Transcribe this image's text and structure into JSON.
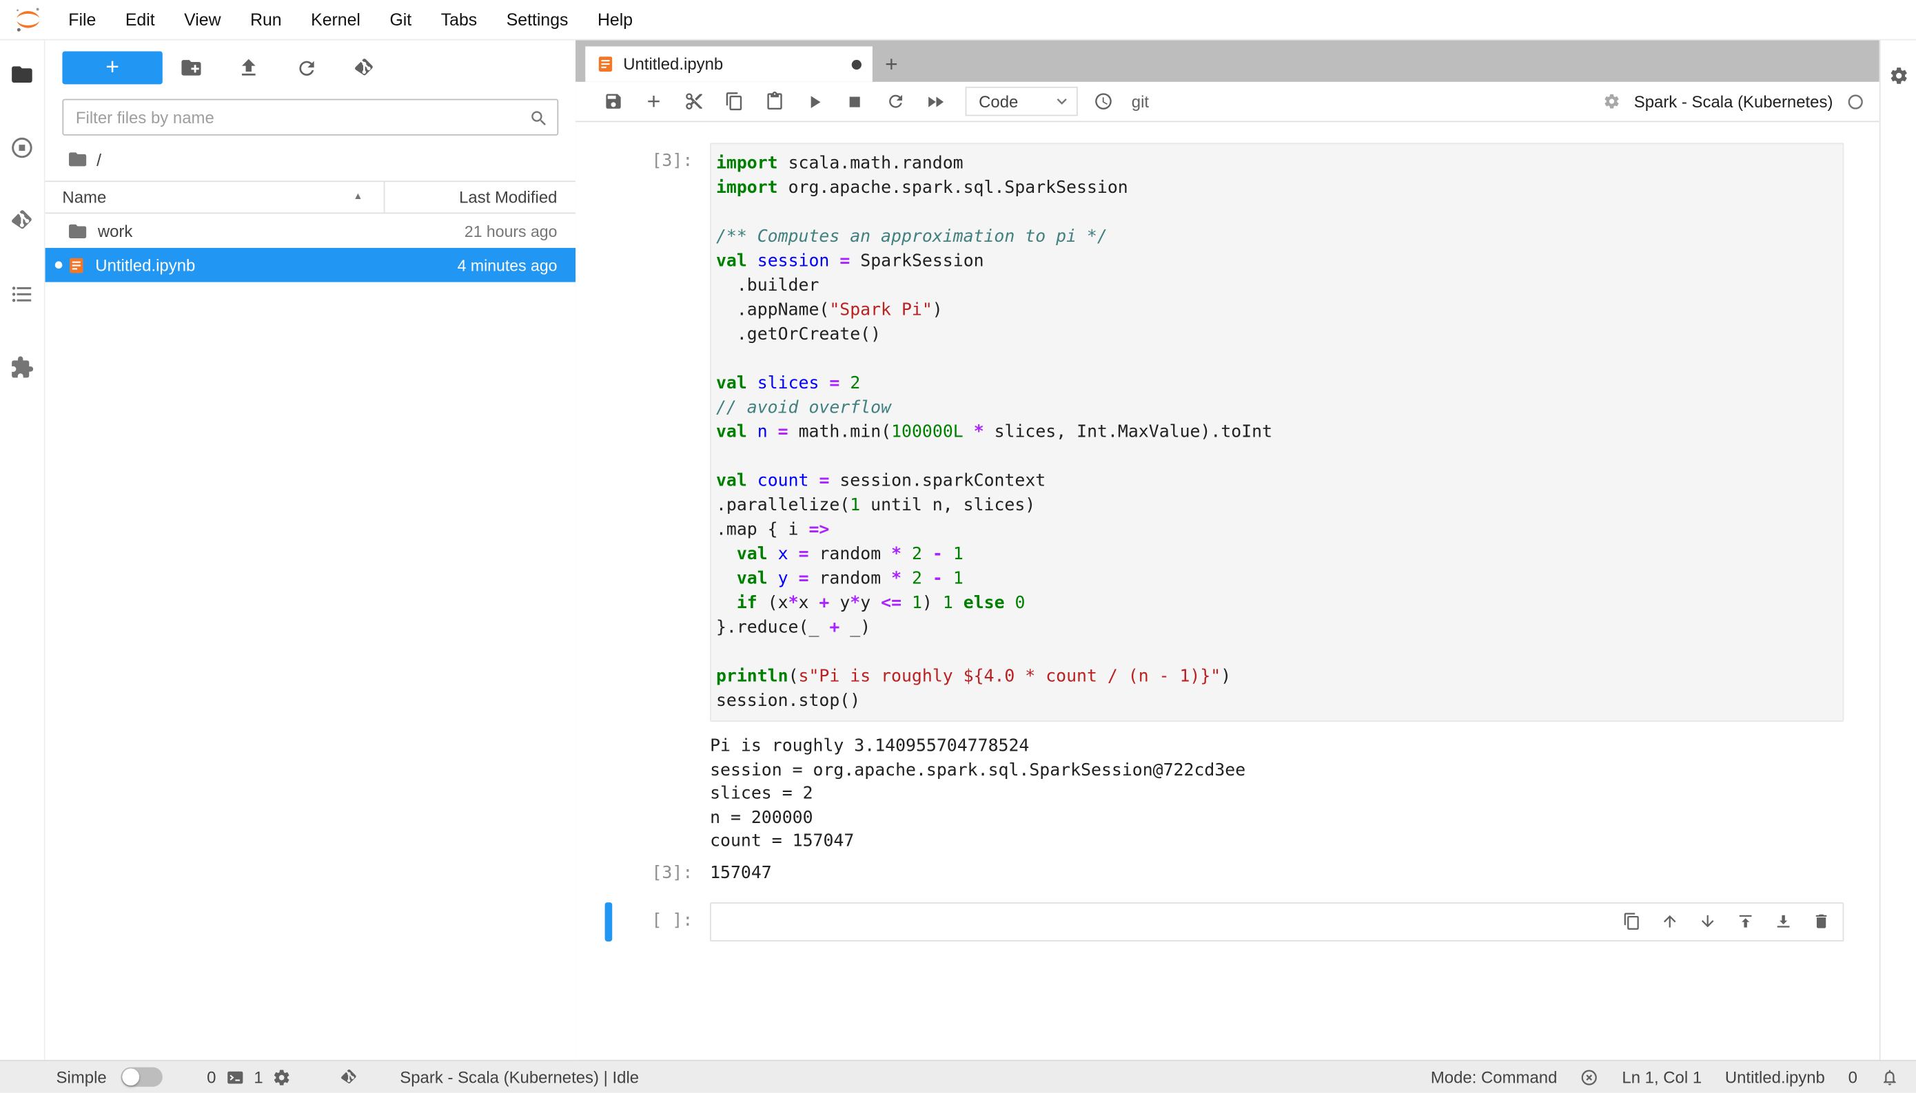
{
  "app": {
    "accent_color": "#2196f3",
    "brand_color": "#f37726",
    "selection_color": "#2196f3"
  },
  "icons": {
    "sort_ascending": "▲"
  },
  "menu_bar": {
    "items": [
      "File",
      "Edit",
      "View",
      "Run",
      "Kernel",
      "Git",
      "Tabs",
      "Settings",
      "Help"
    ]
  },
  "file_browser": {
    "new_launcher_label": "+",
    "filter_placeholder": "Filter files by name",
    "breadcrumb_root": "/",
    "columns": {
      "name": "Name",
      "modified": "Last Modified"
    },
    "rows": [
      {
        "name": "work",
        "modified": "21 hours ago"
      },
      {
        "name": "Untitled.ipynb",
        "modified": "4 minutes ago"
      }
    ]
  },
  "tab_bar": {
    "active_tab": "Untitled.ipynb"
  },
  "notebook_toolbar": {
    "cell_type": "Code",
    "git_label": "git",
    "kernel_name": "Spark - Scala (Kubernetes)"
  },
  "notebook": {
    "cell1": {
      "prompt": "[3]:",
      "lines": [
        [
          [
            "k",
            "import"
          ],
          [
            "p",
            " scala.math.random"
          ]
        ],
        [
          [
            "k",
            "import"
          ],
          [
            "p",
            " org.apache.spark.sql.SparkSession"
          ]
        ],
        [],
        [
          [
            "c",
            "/** Computes an approximation to pi */"
          ]
        ],
        [
          [
            "k",
            "val"
          ],
          [
            "p",
            " "
          ],
          [
            "d",
            "session"
          ],
          [
            "p",
            " "
          ],
          [
            "o",
            "="
          ],
          [
            "p",
            " SparkSession"
          ]
        ],
        [
          [
            "p",
            "  .builder"
          ]
        ],
        [
          [
            "p",
            "  .appName("
          ],
          [
            "s",
            "\"Spark Pi\""
          ],
          [
            "p",
            ")"
          ]
        ],
        [
          [
            "p",
            "  .getOrCreate()"
          ]
        ],
        [],
        [
          [
            "k",
            "val"
          ],
          [
            "p",
            " "
          ],
          [
            "d",
            "slices"
          ],
          [
            "p",
            " "
          ],
          [
            "o",
            "="
          ],
          [
            "p",
            " "
          ],
          [
            "n",
            "2"
          ]
        ],
        [
          [
            "c",
            "// avoid overflow"
          ]
        ],
        [
          [
            "k",
            "val"
          ],
          [
            "p",
            " "
          ],
          [
            "d",
            "n"
          ],
          [
            "p",
            " "
          ],
          [
            "o",
            "="
          ],
          [
            "p",
            " math.min("
          ],
          [
            "n",
            "100000L"
          ],
          [
            "p",
            " "
          ],
          [
            "o",
            "*"
          ],
          [
            "p",
            " slices, Int.MaxValue).toInt"
          ]
        ],
        [],
        [
          [
            "k",
            "val"
          ],
          [
            "p",
            " "
          ],
          [
            "d",
            "count"
          ],
          [
            "p",
            " "
          ],
          [
            "o",
            "="
          ],
          [
            "p",
            " session.sparkContext"
          ]
        ],
        [
          [
            "p",
            ".parallelize("
          ],
          [
            "n",
            "1"
          ],
          [
            "p",
            " until n, slices)"
          ]
        ],
        [
          [
            "p",
            ".map { i "
          ],
          [
            "o",
            "=>"
          ]
        ],
        [
          [
            "p",
            "  "
          ],
          [
            "k",
            "val"
          ],
          [
            "p",
            " "
          ],
          [
            "d",
            "x"
          ],
          [
            "p",
            " "
          ],
          [
            "o",
            "="
          ],
          [
            "p",
            " random "
          ],
          [
            "o",
            "*"
          ],
          [
            "p",
            " "
          ],
          [
            "n",
            "2"
          ],
          [
            "p",
            " "
          ],
          [
            "o",
            "-"
          ],
          [
            "p",
            " "
          ],
          [
            "n",
            "1"
          ]
        ],
        [
          [
            "p",
            "  "
          ],
          [
            "k",
            "val"
          ],
          [
            "p",
            " "
          ],
          [
            "d",
            "y"
          ],
          [
            "p",
            " "
          ],
          [
            "o",
            "="
          ],
          [
            "p",
            " random "
          ],
          [
            "o",
            "*"
          ],
          [
            "p",
            " "
          ],
          [
            "n",
            "2"
          ],
          [
            "p",
            " "
          ],
          [
            "o",
            "-"
          ],
          [
            "p",
            " "
          ],
          [
            "n",
            "1"
          ]
        ],
        [
          [
            "p",
            "  "
          ],
          [
            "k",
            "if"
          ],
          [
            "p",
            " (x"
          ],
          [
            "o",
            "*"
          ],
          [
            "p",
            "x "
          ],
          [
            "o",
            "+"
          ],
          [
            "p",
            " y"
          ],
          [
            "o",
            "*"
          ],
          [
            "p",
            "y "
          ],
          [
            "o",
            "<="
          ],
          [
            "p",
            " "
          ],
          [
            "n",
            "1"
          ],
          [
            "p",
            ") "
          ],
          [
            "n",
            "1"
          ],
          [
            "p",
            " "
          ],
          [
            "k",
            "else"
          ],
          [
            "p",
            " "
          ],
          [
            "n",
            "0"
          ]
        ],
        [
          [
            "p",
            "}.reduce(_ "
          ],
          [
            "o",
            "+"
          ],
          [
            "p",
            " _)"
          ]
        ],
        [],
        [
          [
            "b",
            "println"
          ],
          [
            "p",
            "("
          ],
          [
            "s",
            "s\"Pi is roughly ${4.0 * count / (n - 1)}\""
          ],
          [
            "p",
            ")"
          ]
        ],
        [
          [
            "p",
            "session.stop()"
          ]
        ]
      ],
      "outputs": [
        "Pi is roughly 3.140955704778524",
        "session = org.apache.spark.sql.SparkSession@722cd3ee",
        "slices = 2",
        "n = 200000",
        "count = 157047"
      ],
      "result_prompt": "[3]:",
      "result_value": "157047"
    },
    "cell2": {
      "prompt": "[ ]:"
    }
  },
  "status_bar": {
    "interface_label": "Simple",
    "terminals_count": "0",
    "kernels_count": "1",
    "kernel_status": "Spark - Scala (Kubernetes) | Idle",
    "mode": "Mode: Command",
    "cursor_position": "Ln 1, Col 1",
    "filename": "Untitled.ipynb",
    "notification_count": "0"
  },
  "syntax_colors": {
    "keyword": "#008000",
    "definition": "#0000ff",
    "operator": "#aa22ff",
    "number": "#008000",
    "string": "#ba2121",
    "comment": "#408080"
  }
}
